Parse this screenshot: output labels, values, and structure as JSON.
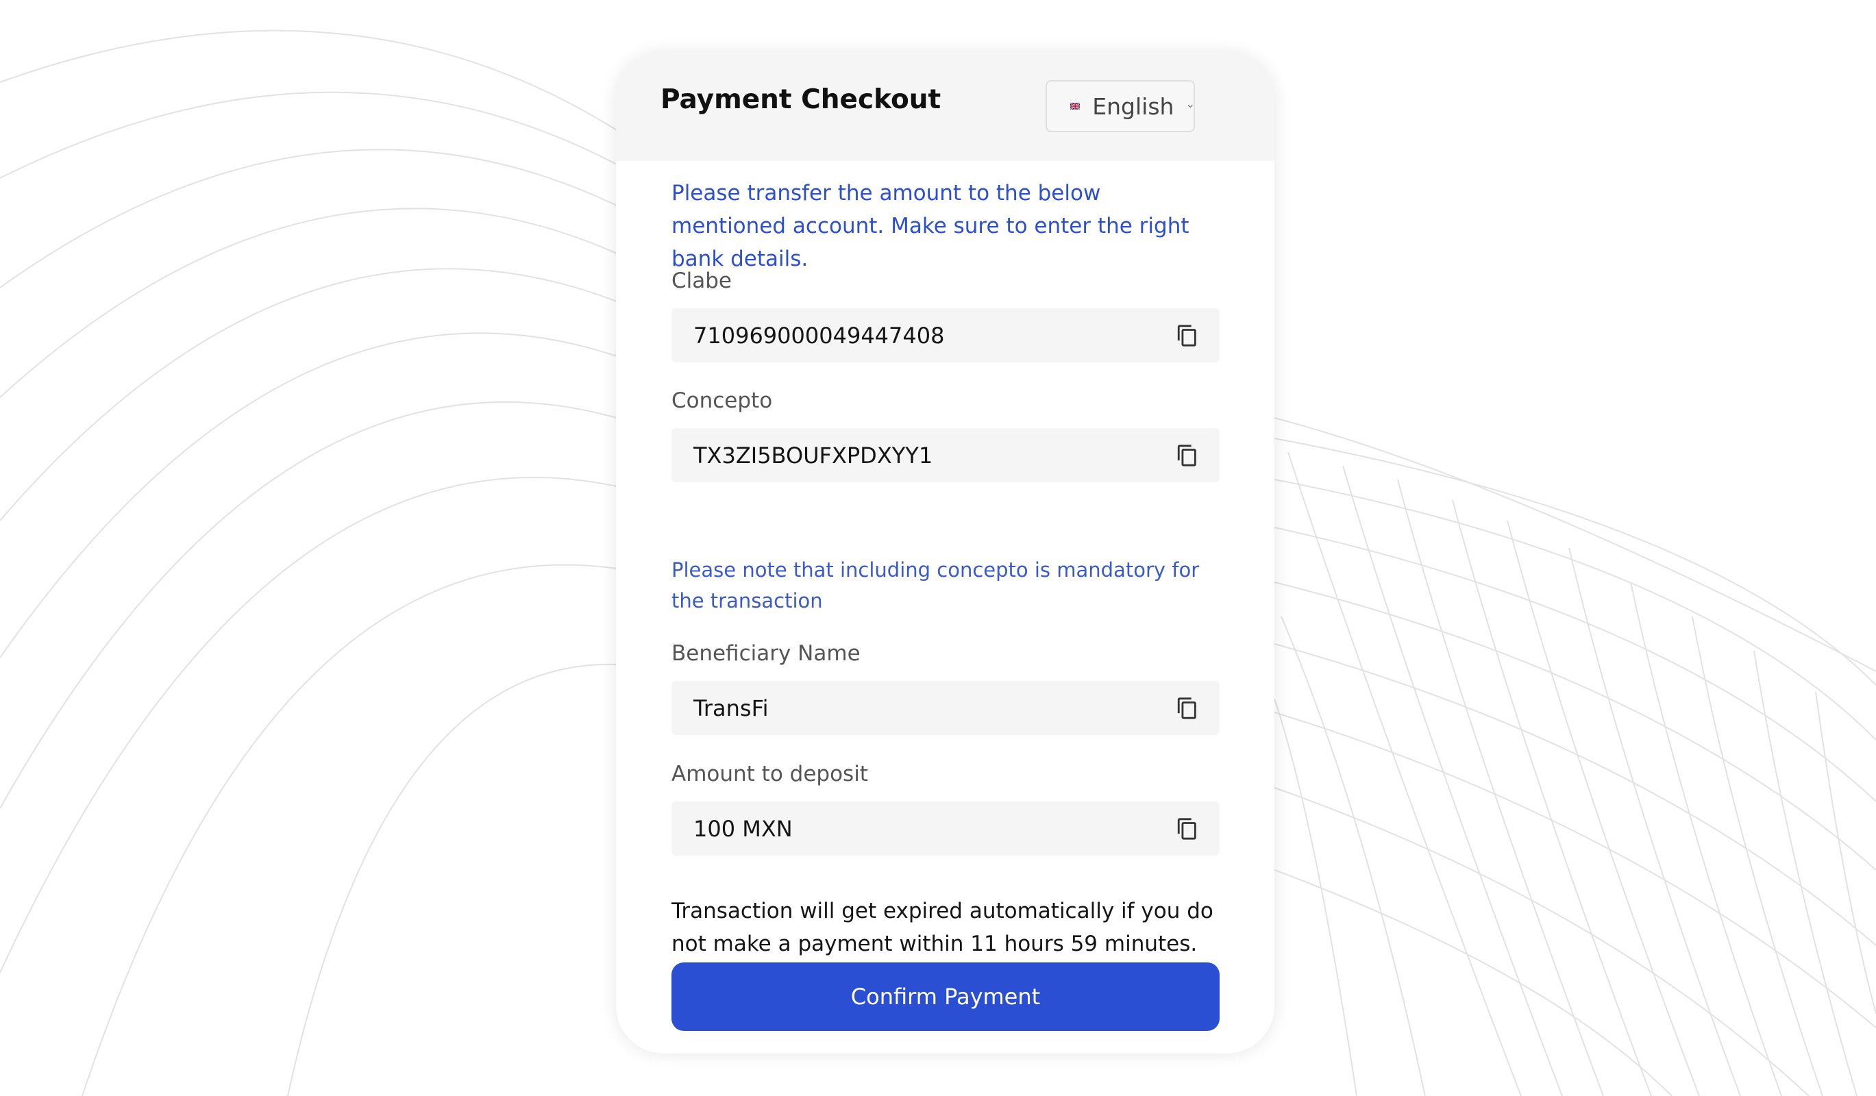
{
  "checkout": {
    "title": "Payment Checkout",
    "language": {
      "selected": "English",
      "flag_icon": "uk-flag-icon"
    },
    "intro_text": "Please transfer the amount to the below mentioned account. Make sure to enter the right bank details.",
    "fields": [
      {
        "label": "Clabe",
        "value": "710969000049447408"
      },
      {
        "label": "Concepto",
        "value": "TX3ZI5BOUFXPDXYY1"
      },
      {
        "label": "Beneficiary Name",
        "value": "TransFi"
      },
      {
        "label": "Amount to deposit",
        "value": "100 MXN"
      }
    ],
    "concepto_note": "Please note that including concepto is mandatory for the transaction",
    "expiry_text": "Transaction will get expired automatically if you do not make a payment within 11 hours 59 minutes.",
    "confirm_label": "Confirm Payment"
  },
  "colors": {
    "accent": "#2a4fd2",
    "info_text": "#2b4fd0",
    "field_bg": "#f5f5f5",
    "header_bg": "#f5f5f5"
  },
  "icons": {
    "copy": "copy-icon",
    "dropdown": "chevron-down-icon"
  }
}
